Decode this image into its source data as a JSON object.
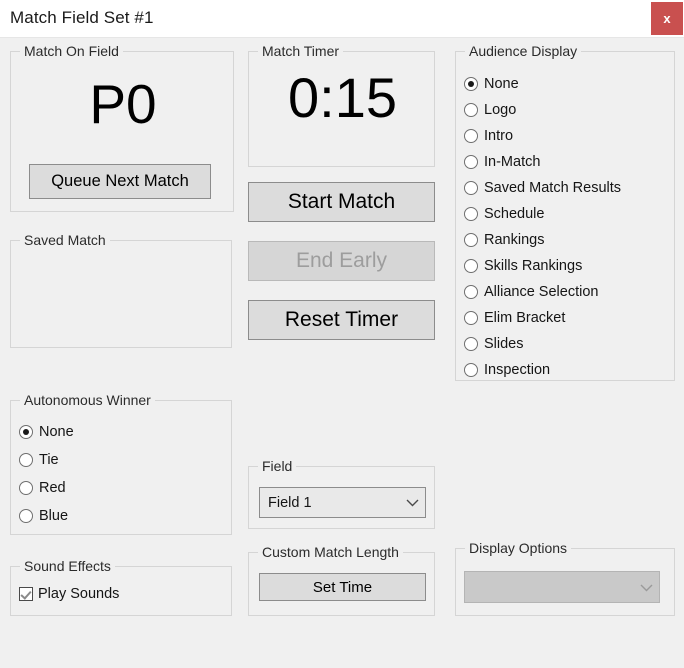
{
  "window": {
    "title": "Match Field Set #1",
    "close_label": "x",
    "accent_close_color": "#c9504f",
    "body_color": "#f0f0f0"
  },
  "match_on_field": {
    "legend": "Match On Field",
    "value": "P0",
    "queue_button": "Queue Next Match"
  },
  "saved_match": {
    "legend": "Saved Match",
    "value": ""
  },
  "autonomous_winner": {
    "legend": "Autonomous Winner",
    "options": [
      {
        "label": "None",
        "selected": true
      },
      {
        "label": "Tie",
        "selected": false
      },
      {
        "label": "Red",
        "selected": false
      },
      {
        "label": "Blue",
        "selected": false
      }
    ]
  },
  "sound_effects": {
    "legend": "Sound Effects",
    "play_sounds_label": "Play Sounds",
    "play_sounds_checked": true
  },
  "match_timer": {
    "legend": "Match Timer",
    "value": "0:15",
    "start_button": "Start Match",
    "end_early_button": "End Early",
    "end_early_disabled": true,
    "reset_button": "Reset Timer"
  },
  "field": {
    "legend": "Field",
    "selected": "Field 1",
    "chevron": "chevron-down-icon"
  },
  "custom_match_length": {
    "legend": "Custom Match Length",
    "set_time_button": "Set Time"
  },
  "audience_display": {
    "legend": "Audience Display",
    "options": [
      {
        "label": "None",
        "selected": true
      },
      {
        "label": "Logo",
        "selected": false
      },
      {
        "label": "Intro",
        "selected": false
      },
      {
        "label": "In-Match",
        "selected": false
      },
      {
        "label": "Saved Match Results",
        "selected": false
      },
      {
        "label": "Schedule",
        "selected": false
      },
      {
        "label": "Rankings",
        "selected": false
      },
      {
        "label": "Skills Rankings",
        "selected": false
      },
      {
        "label": "Alliance Selection",
        "selected": false
      },
      {
        "label": "Elim Bracket",
        "selected": false
      },
      {
        "label": "Slides",
        "selected": false
      },
      {
        "label": "Inspection",
        "selected": false
      }
    ]
  },
  "display_options": {
    "legend": "Display Options",
    "selected": "",
    "disabled": true,
    "chevron": "chevron-down-icon"
  }
}
